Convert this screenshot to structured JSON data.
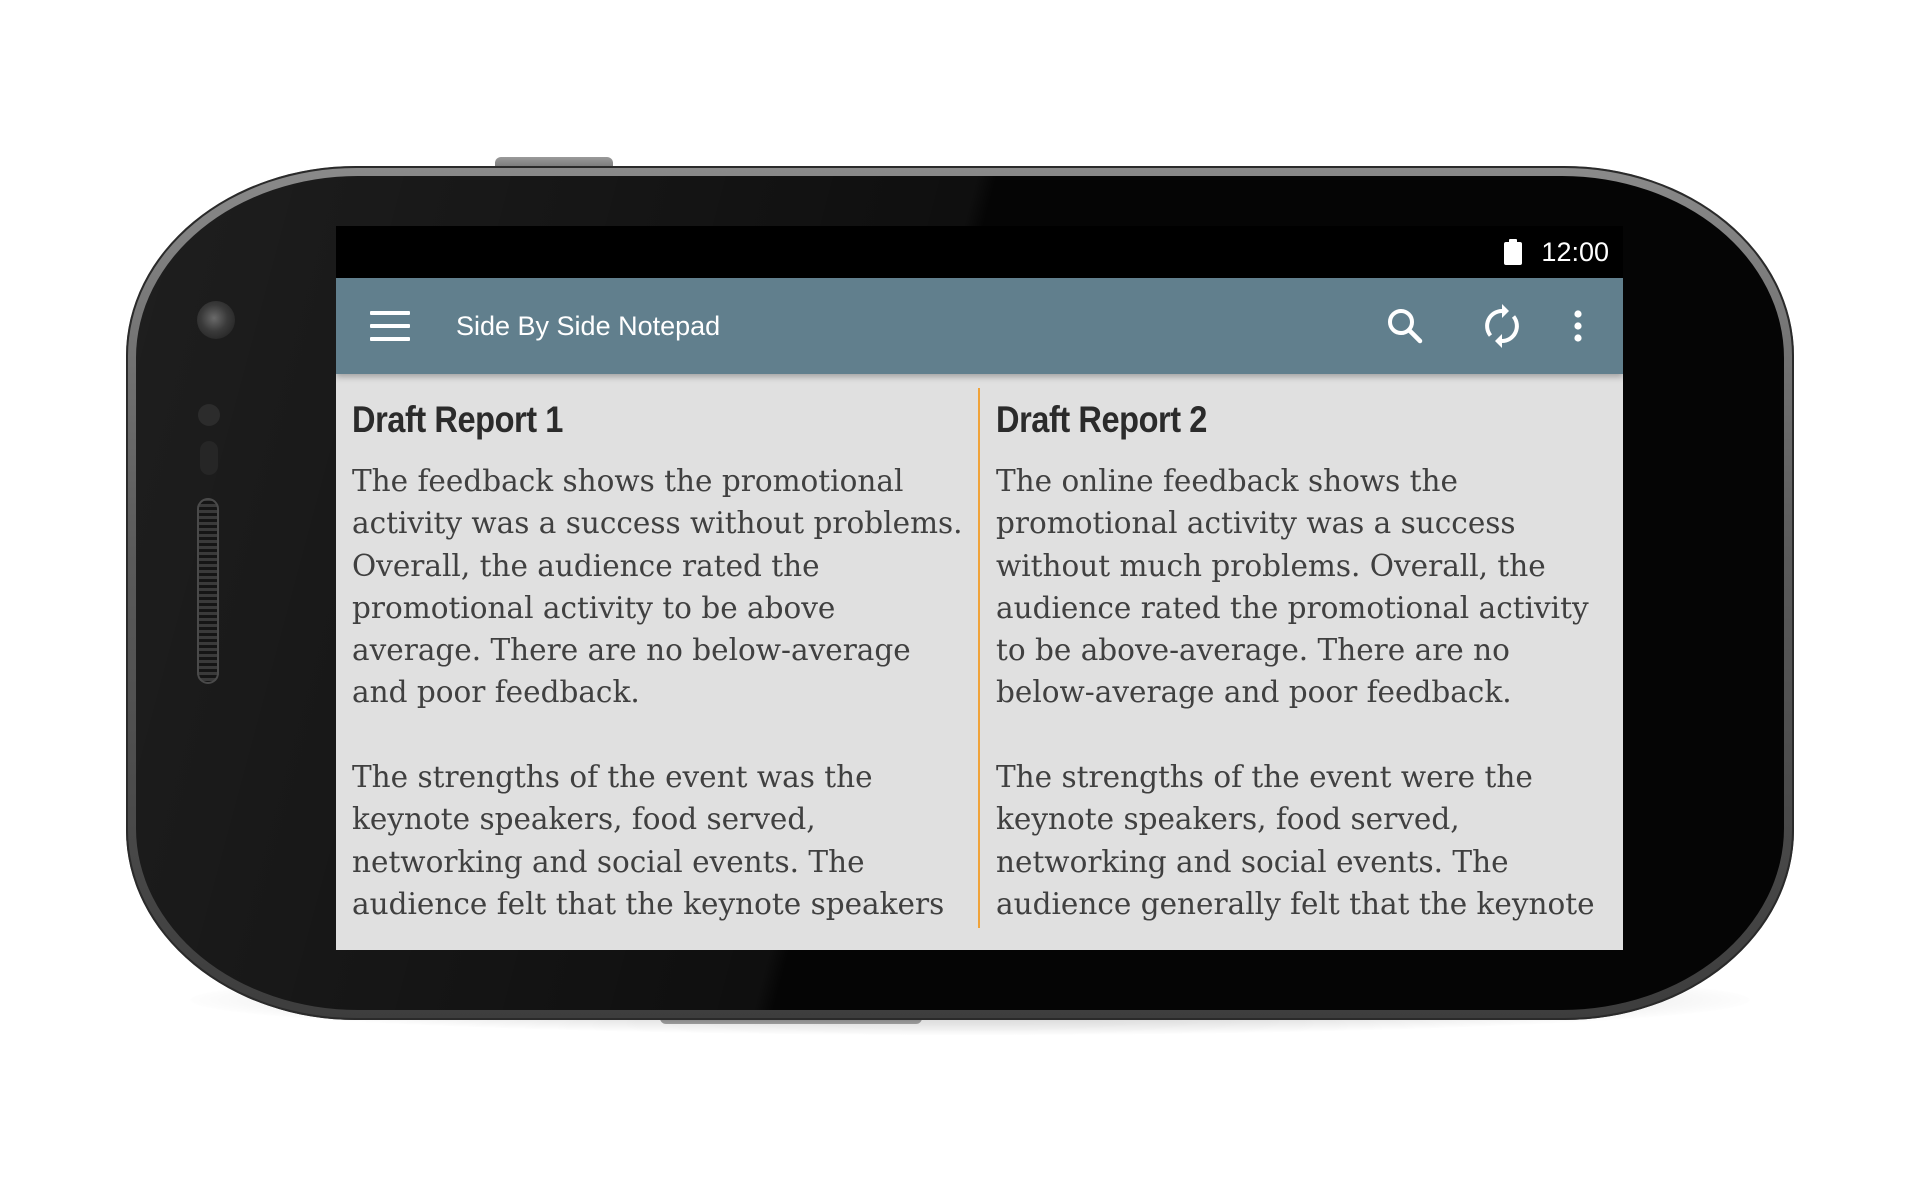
{
  "status_bar": {
    "time": "12:00",
    "battery_icon": "battery-full-icon"
  },
  "app_bar": {
    "title": "Side By Side Notepad",
    "menu_icon": "hamburger-menu-icon",
    "actions": [
      "search-icon",
      "sync-icon",
      "more-vert-icon"
    ]
  },
  "notes": [
    {
      "title": "Draft Report 1",
      "body": "The feedback shows the promotional activity was a success without problems. Overall, the audience rated the promotional activity to be above average. There are no below-average and poor feedback.\n\nThe strengths of the event was the keynote speakers, food served, networking and social events. The audience felt that the keynote speakers"
    },
    {
      "title": "Draft Report 2",
      "body": "The online feedback shows the promotional activity was a success without much problems. Overall, the audience rated the promotional activity to be above-average. There are no below-average and poor feedback.\n\nThe strengths of the event were the keynote speakers, food served, networking and social events. The audience generally felt that the keynote"
    }
  ],
  "colors": {
    "app_bar": "#617f8d",
    "divider": "#f0a33a",
    "content_bg": "#e0e0e0"
  }
}
